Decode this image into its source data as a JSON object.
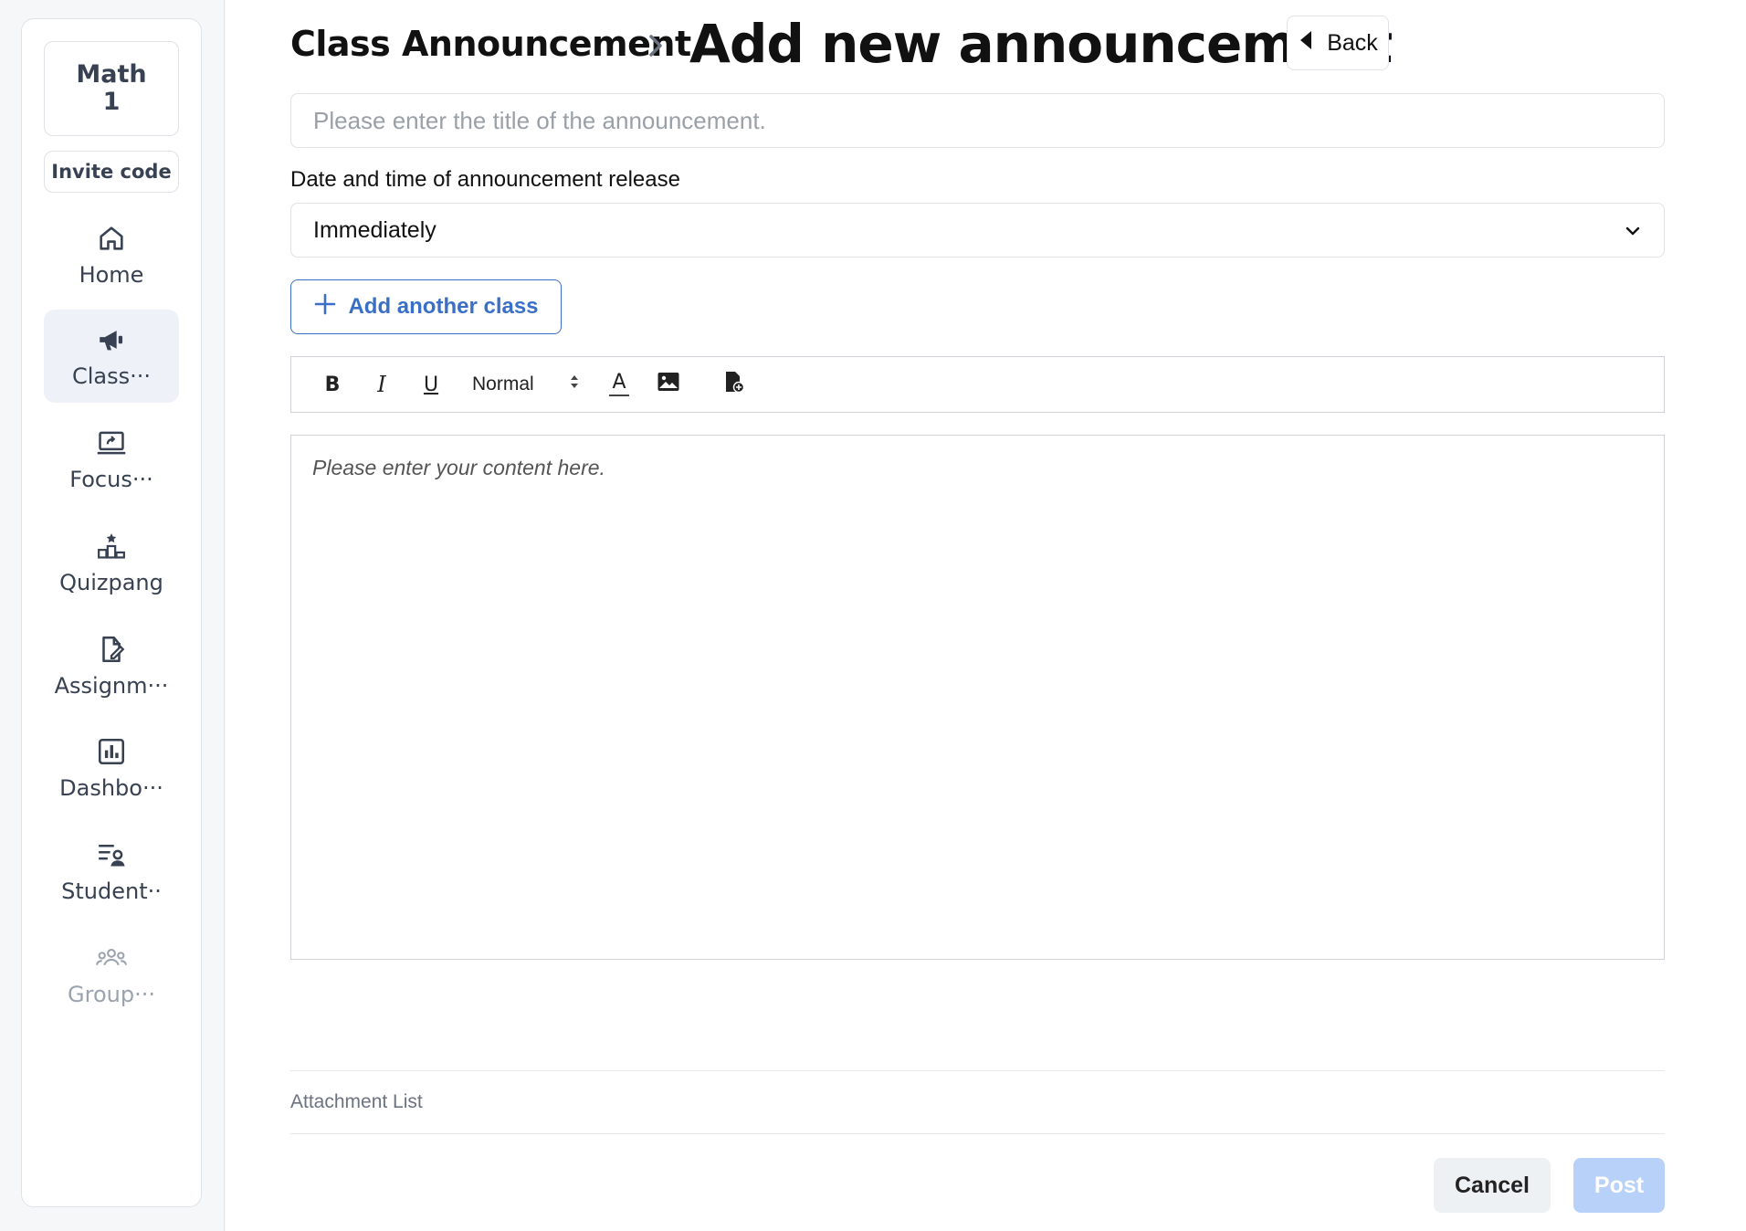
{
  "sidebar": {
    "class_name_line1": "Math",
    "class_name_line2": "1",
    "invite_label": "Invite code",
    "items": [
      {
        "label": "Home",
        "icon": "home-icon"
      },
      {
        "label": "Class···",
        "icon": "megaphone-icon",
        "active": true
      },
      {
        "label": "Focus···",
        "icon": "screen-share-icon"
      },
      {
        "label": "Quizpang",
        "icon": "podium-icon"
      },
      {
        "label": "Assignm···",
        "icon": "file-edit-icon"
      },
      {
        "label": "Dashbo···",
        "icon": "bar-chart-icon"
      },
      {
        "label": "Student··",
        "icon": "student-list-icon"
      },
      {
        "label": "Group···",
        "icon": "group-icon",
        "disabled": true
      }
    ]
  },
  "header": {
    "breadcrumb_parent": "Class Announcement",
    "title": "Add new announcement",
    "back_label": "Back"
  },
  "form": {
    "title_placeholder": "Please enter the title of the announcement.",
    "title_value": "",
    "release_label": "Date and time of announcement release",
    "release_value": "Immediately",
    "add_class_label": "Add another class",
    "toolbar": {
      "bold": "B",
      "italic": "I",
      "underline": "U",
      "format_value": "Normal",
      "text_color_glyph": "A"
    },
    "editor_placeholder": "Please enter your content here.",
    "attachment_label": "Attachment List",
    "cancel_label": "Cancel",
    "post_label": "Post"
  },
  "colors": {
    "accent": "#3a6fc7",
    "post_disabled": "#b8d1f8",
    "sidebar_active_bg": "#eef2f8"
  }
}
